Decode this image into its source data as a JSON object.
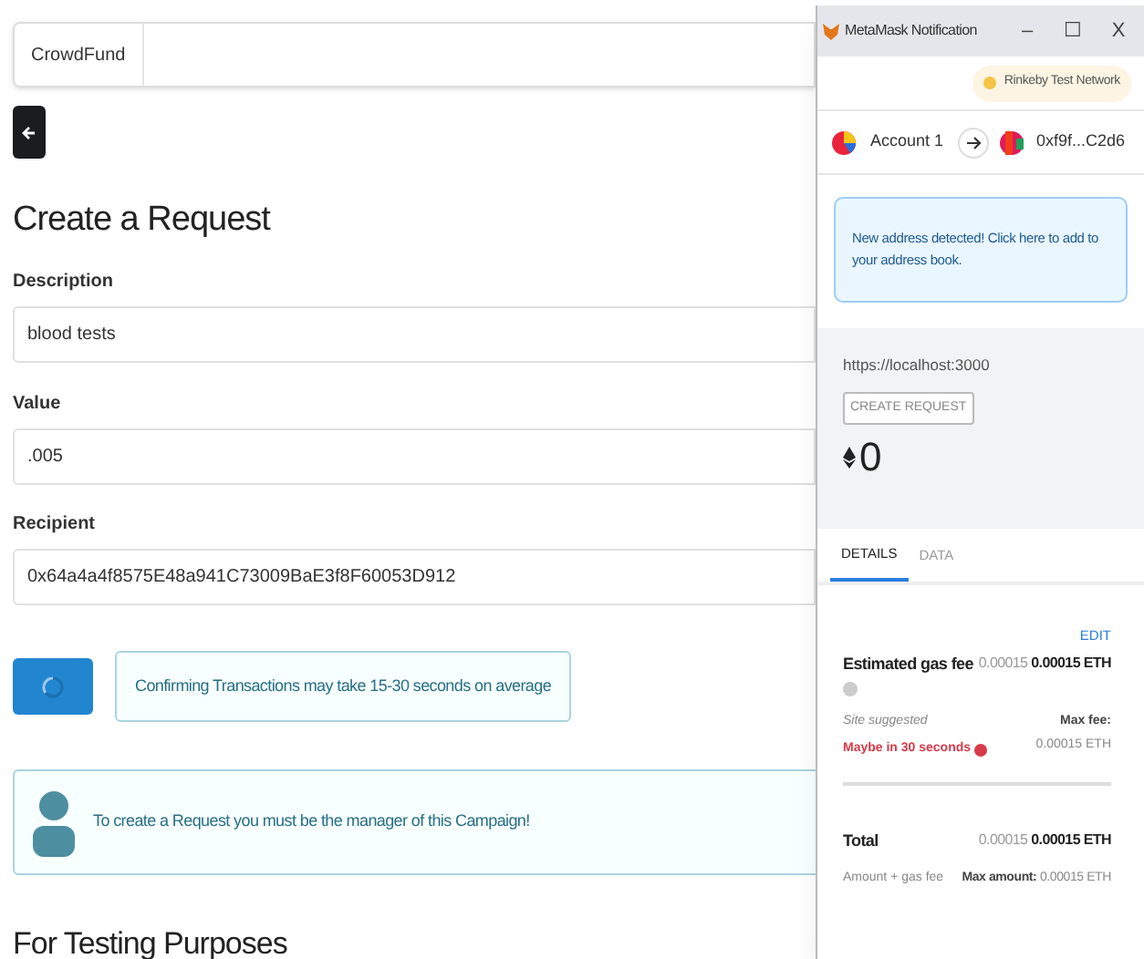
{
  "page": {
    "brand": "CrowdFund",
    "heading": "Create a Request",
    "fields": [
      {
        "label": "Description",
        "value": "blood tests"
      },
      {
        "label": "Value",
        "value": ".005"
      },
      {
        "label": "Recipient",
        "value": "0x64a4a4f8575E48a941C73009BaE3f8F60053D912"
      }
    ],
    "submit": {
      "loading": true
    },
    "pending_message": "Confirming Transactions may take 15-30 seconds on average",
    "manager_notice": "To create a Request you must be the manager of this Campaign!",
    "section_heading": "For Testing Purposes"
  },
  "popup": {
    "title": "MetaMask Notification",
    "controls": [
      "–",
      "☐",
      "X"
    ],
    "network": "Rinkeby Test Network",
    "from": "Account 1",
    "to": "0xf9f...C2d6",
    "alert": "New address detected! Click here to add to your address book.",
    "origin": "https://localhost:3000",
    "method": "CREATE REQUEST",
    "amount": "0",
    "tabs": [
      {
        "label": "DETAILS",
        "selected": true
      },
      {
        "label": "DATA",
        "selected": false
      }
    ],
    "edit": "EDIT",
    "gas": {
      "label": "Estimated gas fee",
      "secondary": "0.00015",
      "primary": "0.00015 ETH",
      "source": "Site suggested",
      "timing": "Maybe in 30 seconds",
      "max_label": "Max fee:",
      "max_value": "0.00015 ETH"
    },
    "total": {
      "label": "Total",
      "secondary": "0.00015",
      "primary": "0.00015 ETH",
      "sub": "Amount + gas fee",
      "max_label": "Max amount:",
      "max_value": "0.00015 ETH"
    }
  }
}
